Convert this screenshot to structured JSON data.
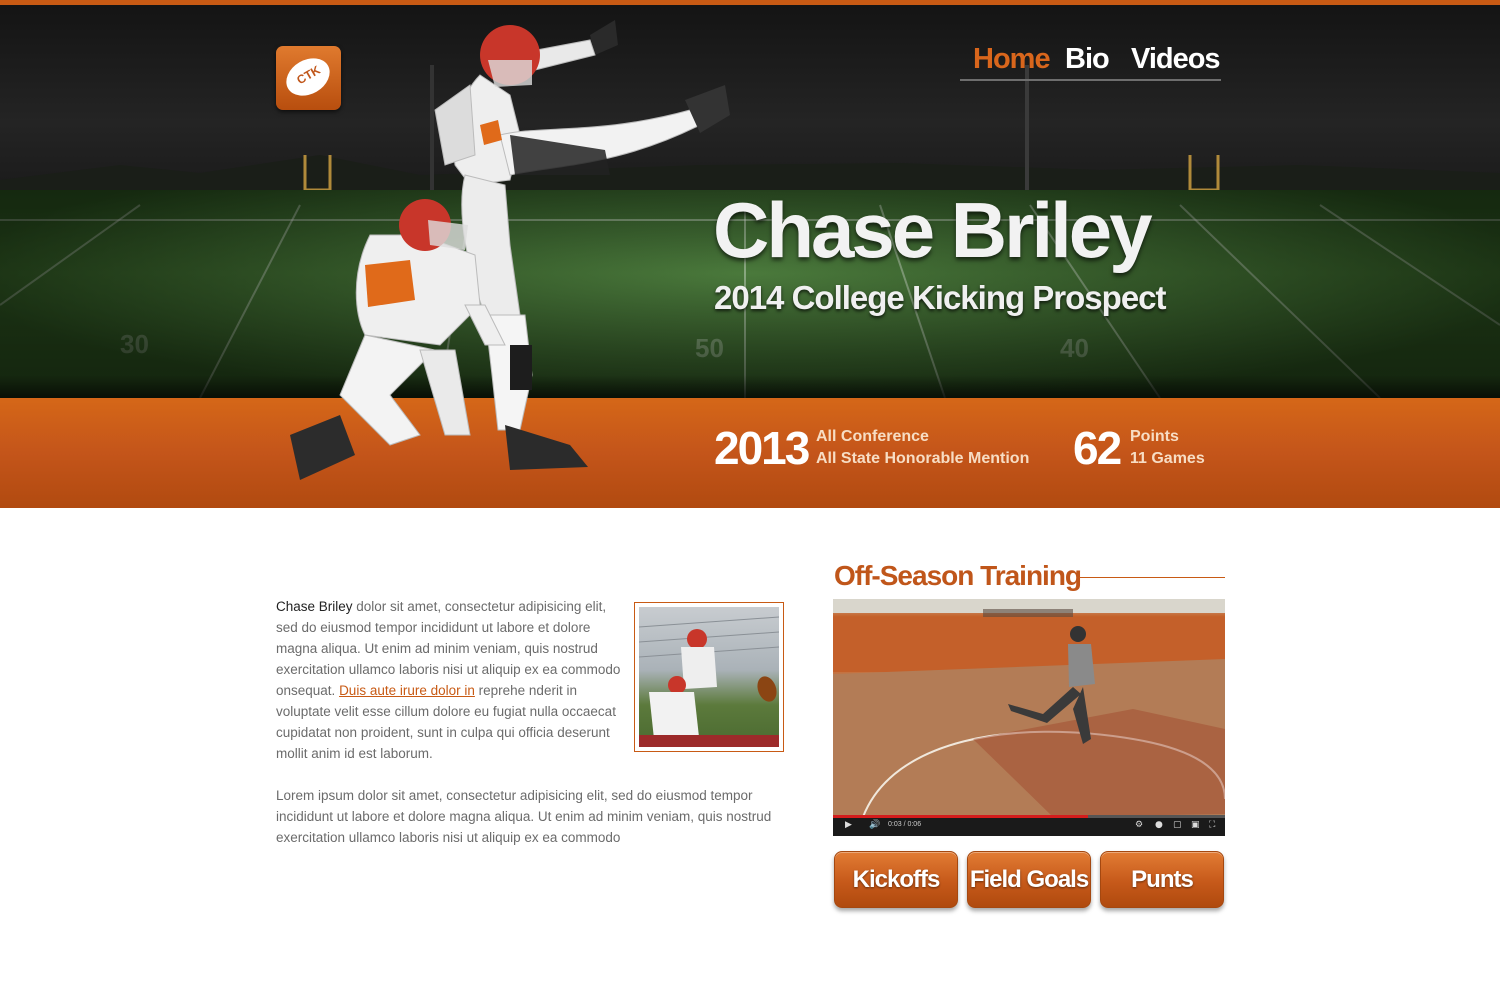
{
  "logo": {
    "text": "CTK"
  },
  "nav": {
    "home": "Home",
    "bio": "Bio",
    "videos": "Videos"
  },
  "hero": {
    "name": "Chase Briley",
    "tagline": "2014 College Kicking Prospect",
    "field_numbers": [
      "30",
      "50",
      "40"
    ]
  },
  "stats": {
    "year": "2013",
    "honor_1": "All Conference",
    "honor_2": "All State Honorable Mention",
    "points": "62",
    "points_label": "Points",
    "games_label": "11 Games"
  },
  "intro": {
    "name": "Chase Briley",
    "text_1": " dolor sit amet, consectetur adipisicing elit, sed do eiusmod tempor incididunt ut labore et dolore magna aliqua. Ut enim ad minim veniam, quis nostrud exercitation ullamco laboris nisi ut aliquip ex ea commodo onsequat. ",
    "link": "Duis aute irure dolor in",
    "text_2": " reprehe nderit in voluptate velit esse cillum dolore eu fugiat nulla occaecat cupidatat non proident, sunt in culpa qui officia deserunt mollit anim id est laborum.",
    "para_2": "Lorem ipsum dolor sit amet, consectetur adipisicing elit, sed do eiusmod tempor incididunt ut labore et dolore magna aliqua. Ut enim ad minim veniam, quis nostrud exercitation ullamco laboris nisi ut aliquip ex ea commodo"
  },
  "training": {
    "title": "Off-Season Training",
    "video_time": "0:03 / 0:06",
    "progress": 0.65
  },
  "buttons": {
    "kickoffs": "Kickoffs",
    "field_goals": "Field Goals",
    "punts": "Punts"
  },
  "colors": {
    "accent": "#c85a14",
    "nav_active": "#d9661c"
  }
}
